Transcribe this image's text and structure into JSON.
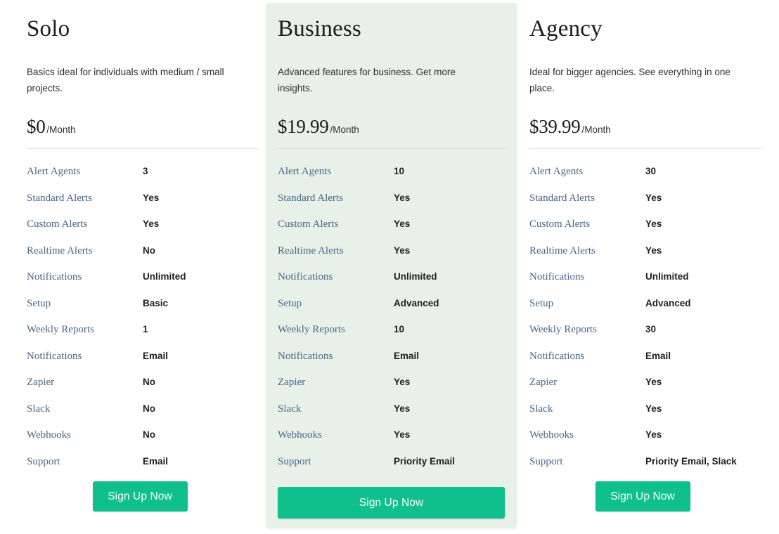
{
  "page": {
    "background": "#ffffff",
    "accent_green": "#0fbf8c",
    "featured_background": "#e7f1e7",
    "label_color": "#47668a",
    "value_color": "#1f1f1f",
    "divider_color": "#e2e2e2"
  },
  "feature_labels": [
    "Alert Agents",
    "Standard Alerts",
    "Custom Alerts",
    "Realtime Alerts",
    "Notifications",
    "Setup",
    "Weekly Reports",
    "Notifications",
    "Zapier",
    "Slack",
    "Webhooks",
    "Support"
  ],
  "plans": [
    {
      "name": "Solo",
      "description": "Basics ideal for individuals with medium / small projects.",
      "price_amount": "$0",
      "price_period": "/Month",
      "featured": false,
      "cta_label": "Sign Up Now",
      "values": [
        "3",
        "Yes",
        "Yes",
        "No",
        "Unlimited",
        "Basic",
        "1",
        "Email",
        "No",
        "No",
        "No",
        "Email"
      ]
    },
    {
      "name": "Business",
      "description": "Advanced features for business. Get more insights.",
      "price_amount": "$19.99",
      "price_period": "/Month",
      "featured": true,
      "cta_label": "Sign Up Now",
      "values": [
        "10",
        "Yes",
        "Yes",
        "Yes",
        "Unlimited",
        "Advanced",
        "10",
        "Email",
        "Yes",
        "Yes",
        "Yes",
        "Priority Email"
      ]
    },
    {
      "name": "Agency",
      "description": "Ideal for bigger agencies. See everything in one place.",
      "price_amount": "$39.99",
      "price_period": "/Month",
      "featured": false,
      "cta_label": "Sign Up Now",
      "values": [
        "30",
        "Yes",
        "Yes",
        "Yes",
        "Unlimited",
        "Advanced",
        "30",
        "Email",
        "Yes",
        "Yes",
        "Yes",
        "Priority Email, Slack"
      ]
    }
  ]
}
